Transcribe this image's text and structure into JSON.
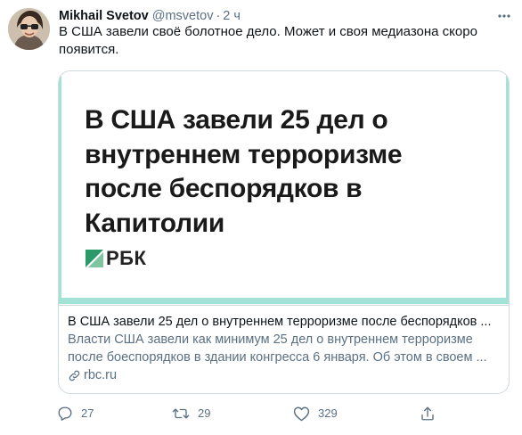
{
  "tweet": {
    "author_name": "Mikhail Svetov",
    "handle": "@msvetov",
    "separator": "·",
    "timestamp": "2 ч",
    "text": "В США завели своё болотное дело. Может и своя медиазона скоро появится."
  },
  "card": {
    "image_headline": "В США завели 25 дел о внутреннем терроризме после беспорядков в Капитолии",
    "image_logo_text": "РБК",
    "title": "В США завели 25 дел о внутреннем терроризме после беспорядков ...",
    "description": "Власти США завели как минимум 25 дел о внутреннем терроризме после боеспорядков в здании конгресса 6 января. Об этом в своем ...",
    "domain": "rbc.ru"
  },
  "actions": {
    "reply_count": "27",
    "retweet_count": "29",
    "like_count": "329"
  },
  "icons": {
    "more": "more-icon",
    "reply": "reply-icon",
    "retweet": "retweet-icon",
    "like": "like-icon",
    "share": "share-icon",
    "link": "link-icon"
  },
  "colors": {
    "secondary_text": "#5b7083",
    "card_border": "#cfd9de",
    "image_frame": "#a3e2d6",
    "rbc_green": "#2a9a69"
  }
}
